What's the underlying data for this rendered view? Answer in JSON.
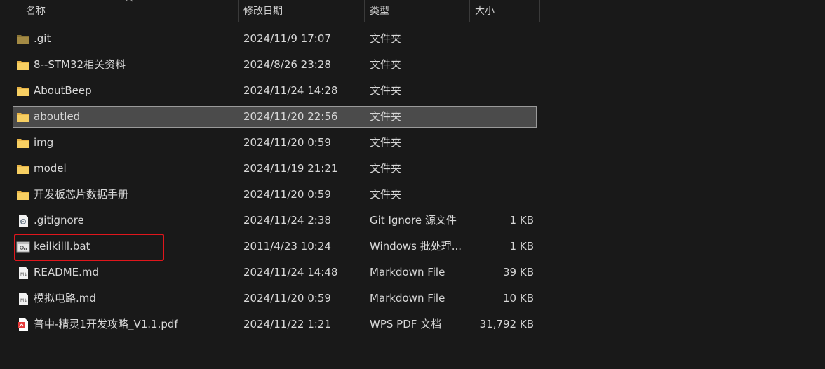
{
  "columns": {
    "name": "名称",
    "modified": "修改日期",
    "type": "类型",
    "size": "大小"
  },
  "rows": [
    {
      "name": ".git",
      "modified": "2024/11/9 17:07",
      "type": "文件夹",
      "size": "",
      "icon": "folder-dark-icon"
    },
    {
      "name": "8--STM32相关资料",
      "modified": "2024/8/26 23:28",
      "type": "文件夹",
      "size": "",
      "icon": "folder-icon"
    },
    {
      "name": "AboutBeep",
      "modified": "2024/11/24 14:28",
      "type": "文件夹",
      "size": "",
      "icon": "folder-icon"
    },
    {
      "name": "aboutled",
      "modified": "2024/11/20 22:56",
      "type": "文件夹",
      "size": "",
      "icon": "folder-icon",
      "selected": true
    },
    {
      "name": "img",
      "modified": "2024/11/20 0:59",
      "type": "文件夹",
      "size": "",
      "icon": "folder-icon"
    },
    {
      "name": "model",
      "modified": "2024/11/19 21:21",
      "type": "文件夹",
      "size": "",
      "icon": "folder-icon"
    },
    {
      "name": "开发板芯片数据手册",
      "modified": "2024/11/20 0:59",
      "type": "文件夹",
      "size": "",
      "icon": "folder-icon"
    },
    {
      "name": ".gitignore",
      "modified": "2024/11/24 2:38",
      "type": "Git Ignore 源文件",
      "size": "1 KB",
      "icon": "gitignore-file-icon"
    },
    {
      "name": "keilkilll.bat",
      "modified": "2011/4/23 10:24",
      "type": "Windows 批处理...",
      "size": "1 KB",
      "icon": "batch-file-icon"
    },
    {
      "name": "README.md",
      "modified": "2024/11/24 14:48",
      "type": "Markdown File",
      "size": "39 KB",
      "icon": "markdown-file-icon"
    },
    {
      "name": "模拟电路.md",
      "modified": "2024/11/20 0:59",
      "type": "Markdown File",
      "size": "10 KB",
      "icon": "markdown-file-icon"
    },
    {
      "name": "普中-精灵1开发攻略_V1.1.pdf",
      "modified": "2024/11/22 1:21",
      "type": "WPS PDF 文档",
      "size": "31,792 KB",
      "icon": "pdf-file-icon"
    }
  ],
  "colors": {
    "background": "#191919",
    "selected_row": "#4b4b4b",
    "highlight_box": "#e0161c",
    "folder": "#f2c55c"
  }
}
